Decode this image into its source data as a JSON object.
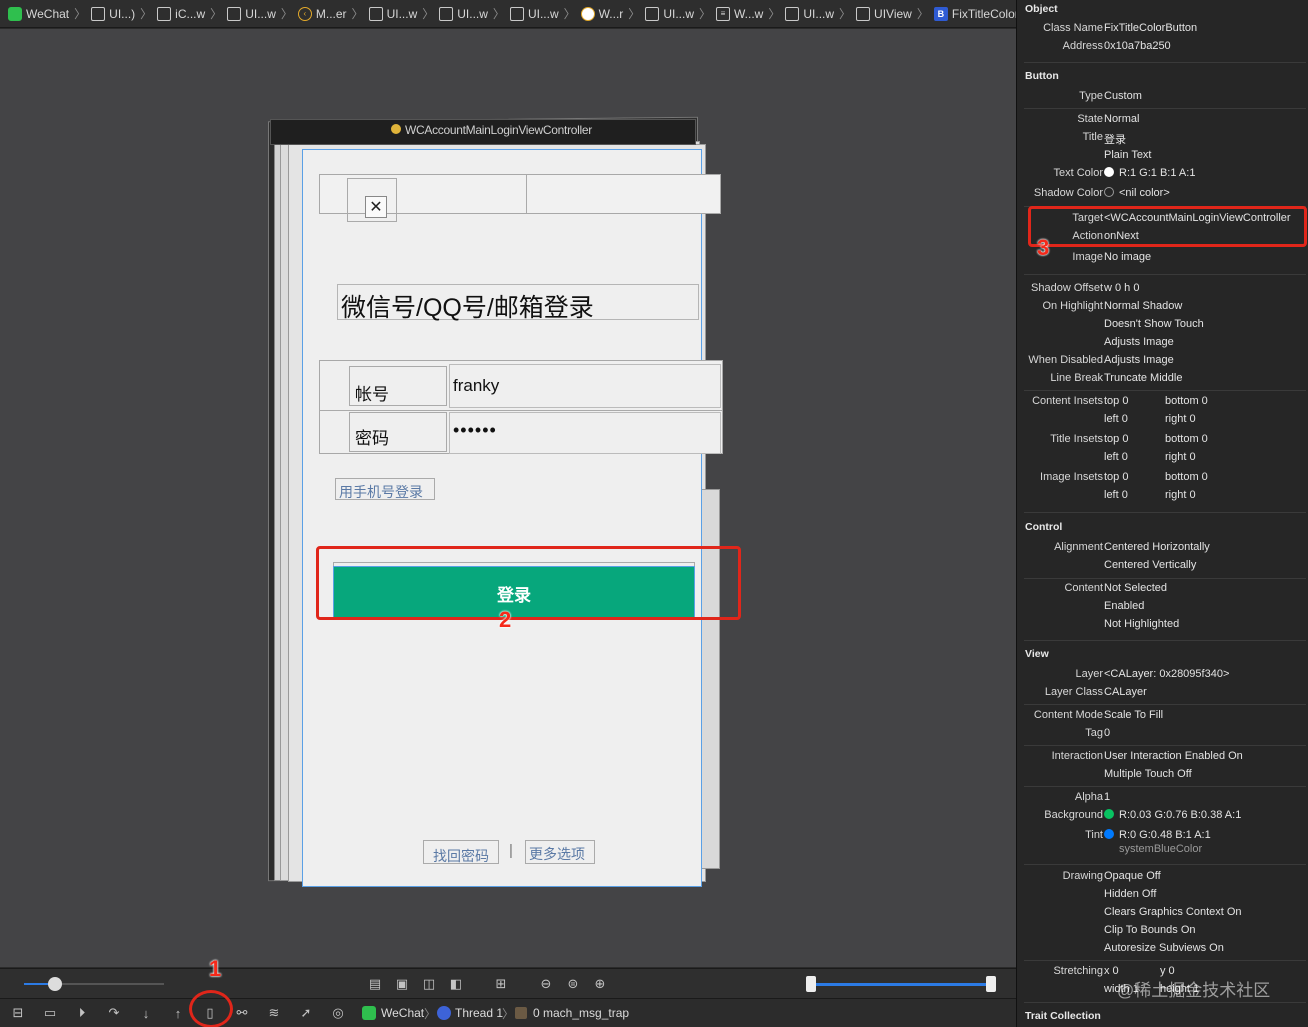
{
  "jumpbar": {
    "items": [
      {
        "icon": "wechat-app-icon",
        "label": "WeChat"
      },
      {
        "icon": "view-icon",
        "label": "UI...)"
      },
      {
        "icon": "view-icon",
        "label": "iC...w"
      },
      {
        "icon": "view-icon",
        "label": "UI...w"
      },
      {
        "icon": "back-icon",
        "label": "M...er"
      },
      {
        "icon": "view-icon",
        "label": "UI...w"
      },
      {
        "icon": "view-icon",
        "label": "UI...w"
      },
      {
        "icon": "view-icon",
        "label": "UI...w"
      },
      {
        "icon": "window-icon",
        "label": "W...r"
      },
      {
        "icon": "view-icon",
        "label": "UI...w"
      },
      {
        "icon": "list-icon",
        "label": "W...w"
      },
      {
        "icon": "view-icon",
        "label": "UI...w"
      },
      {
        "icon": "view-icon",
        "label": "UIView"
      },
      {
        "icon": "button-icon",
        "label": "FixTitleColorButton - 登录"
      }
    ],
    "nav": "〈 ⚠ 〉"
  },
  "scene": {
    "nav_title": "WCAccountMainLoginViewController",
    "close_glyph": "✕",
    "heading": "微信号/QQ号/邮箱登录",
    "account_label": "帐号",
    "account_value": "franky",
    "password_label": "密码",
    "password_value": "••••••",
    "phone_login": "用手机号登录",
    "login_button": "登录",
    "find_password": "找回密码",
    "divider": "|",
    "more_options": "更多选项"
  },
  "colors": {
    "login_button_bg": "#07a77c",
    "highlight": "#e0261a",
    "canvas_bg": "#444446"
  },
  "annotations": {
    "one": "1",
    "two": "2",
    "three": "3"
  },
  "debugbar": {
    "app": "WeChat",
    "thread": "Thread 1",
    "frame": "0 mach_msg_trap"
  },
  "watermark": "@稀土掘金技术社区",
  "inspector": {
    "object_title": "Object",
    "class_name_label": "Class Name",
    "class_name": "FixTitleColorButton",
    "address_label": "Address",
    "address": "0x10a7ba250",
    "button_title": "Button",
    "type_label": "Type",
    "type": "Custom",
    "state_label": "State",
    "state": "Normal",
    "title_label": "Title",
    "title": "登录",
    "title_kind": "Plain Text",
    "text_color_label": "Text Color",
    "text_color": "R:1 G:1 B:1 A:1",
    "shadow_color_label": "Shadow Color",
    "shadow_color": "<nil color>",
    "target_label": "Target",
    "target": "<WCAccountMainLoginViewController",
    "action_label": "Action",
    "action": "onNext",
    "image_label": "Image",
    "image": "No image",
    "shadow_offset_label": "Shadow Offset",
    "shadow_offset": "w 0    h 0",
    "on_highlight_label": "On Highlight",
    "on_highlight": [
      "Normal Shadow",
      "Doesn't Show Touch",
      "Adjusts Image"
    ],
    "when_disabled_label": "When Disabled",
    "when_disabled": "Adjusts Image",
    "line_break_label": "Line Break",
    "line_break": "Truncate Middle",
    "content_insets_label": "Content Insets",
    "title_insets_label": "Title Insets",
    "image_insets_label": "Image Insets",
    "inset_top": "top  0",
    "inset_left": "left  0",
    "inset_bottom": "bottom  0",
    "inset_right": "right  0",
    "control_title": "Control",
    "alignment_label": "Alignment",
    "alignment": [
      "Centered Horizontally",
      "Centered Vertically"
    ],
    "content_label": "Content",
    "content": [
      "Not Selected",
      "Enabled",
      "Not Highlighted"
    ],
    "view_title": "View",
    "layer_label": "Layer",
    "layer": "<CALayer: 0x28095f340>",
    "layer_class_label": "Layer Class",
    "layer_class": "CALayer",
    "content_mode_label": "Content Mode",
    "content_mode": "Scale To Fill",
    "tag_label": "Tag",
    "tag": "0",
    "interaction_label": "Interaction",
    "interaction": [
      "User Interaction Enabled On",
      "Multiple Touch Off"
    ],
    "alpha_label": "Alpha",
    "alpha": "1",
    "background_label": "Background",
    "background": "R:0.03 G:0.76 B:0.38 A:1",
    "tint_label": "Tint",
    "tint": "R:0 G:0.48 B:1 A:1",
    "tint_name": "systemBlueColor",
    "drawing_label": "Drawing",
    "drawing": [
      "Opaque Off",
      "Hidden Off",
      "Clears Graphics Context On",
      "Clip To Bounds On",
      "Autoresize Subviews On"
    ],
    "stretching_label": "Stretching",
    "stretching_a": "x 0",
    "stretching_b": "y 0",
    "stretching_c": "width 1",
    "stretching_d": "height 1",
    "trait_title": "Trait Collection"
  }
}
